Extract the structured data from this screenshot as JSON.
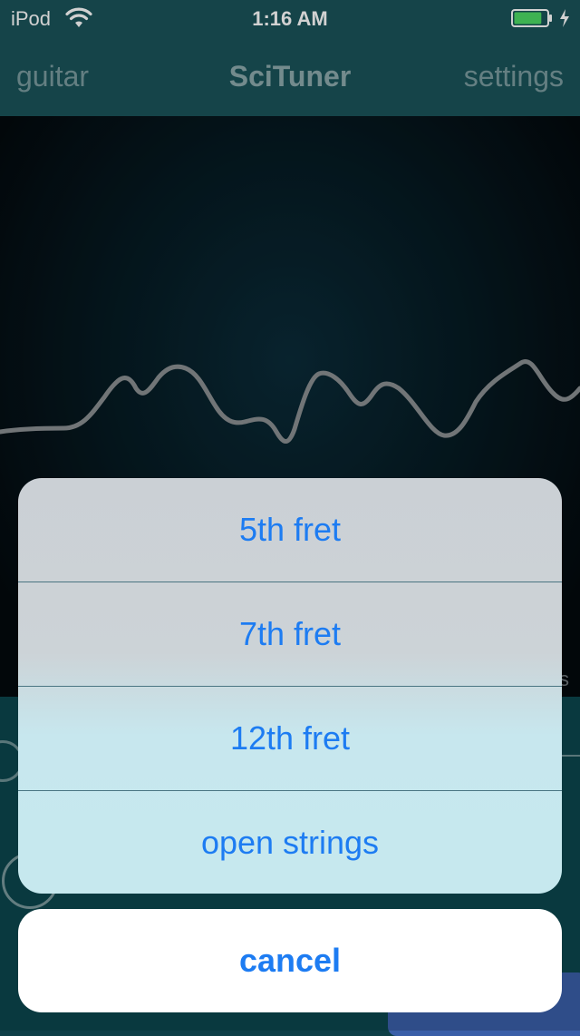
{
  "status_bar": {
    "carrier": "iPod",
    "time": "1:16 AM",
    "wifi_icon": "wifi-icon",
    "battery_icon": "battery-charging-icon",
    "battery_level": 0.85,
    "battery_color": "#4cd964"
  },
  "nav": {
    "left": "guitar",
    "title": "SciTuner",
    "right": "settings"
  },
  "scope": {
    "edge_text": "s"
  },
  "action_sheet": {
    "items": [
      "5th fret",
      "7th fret",
      "12th fret",
      "open strings"
    ],
    "cancel": "cancel"
  },
  "colors": {
    "accent": "#1d7cf2",
    "nav_background": "#1a545a"
  }
}
